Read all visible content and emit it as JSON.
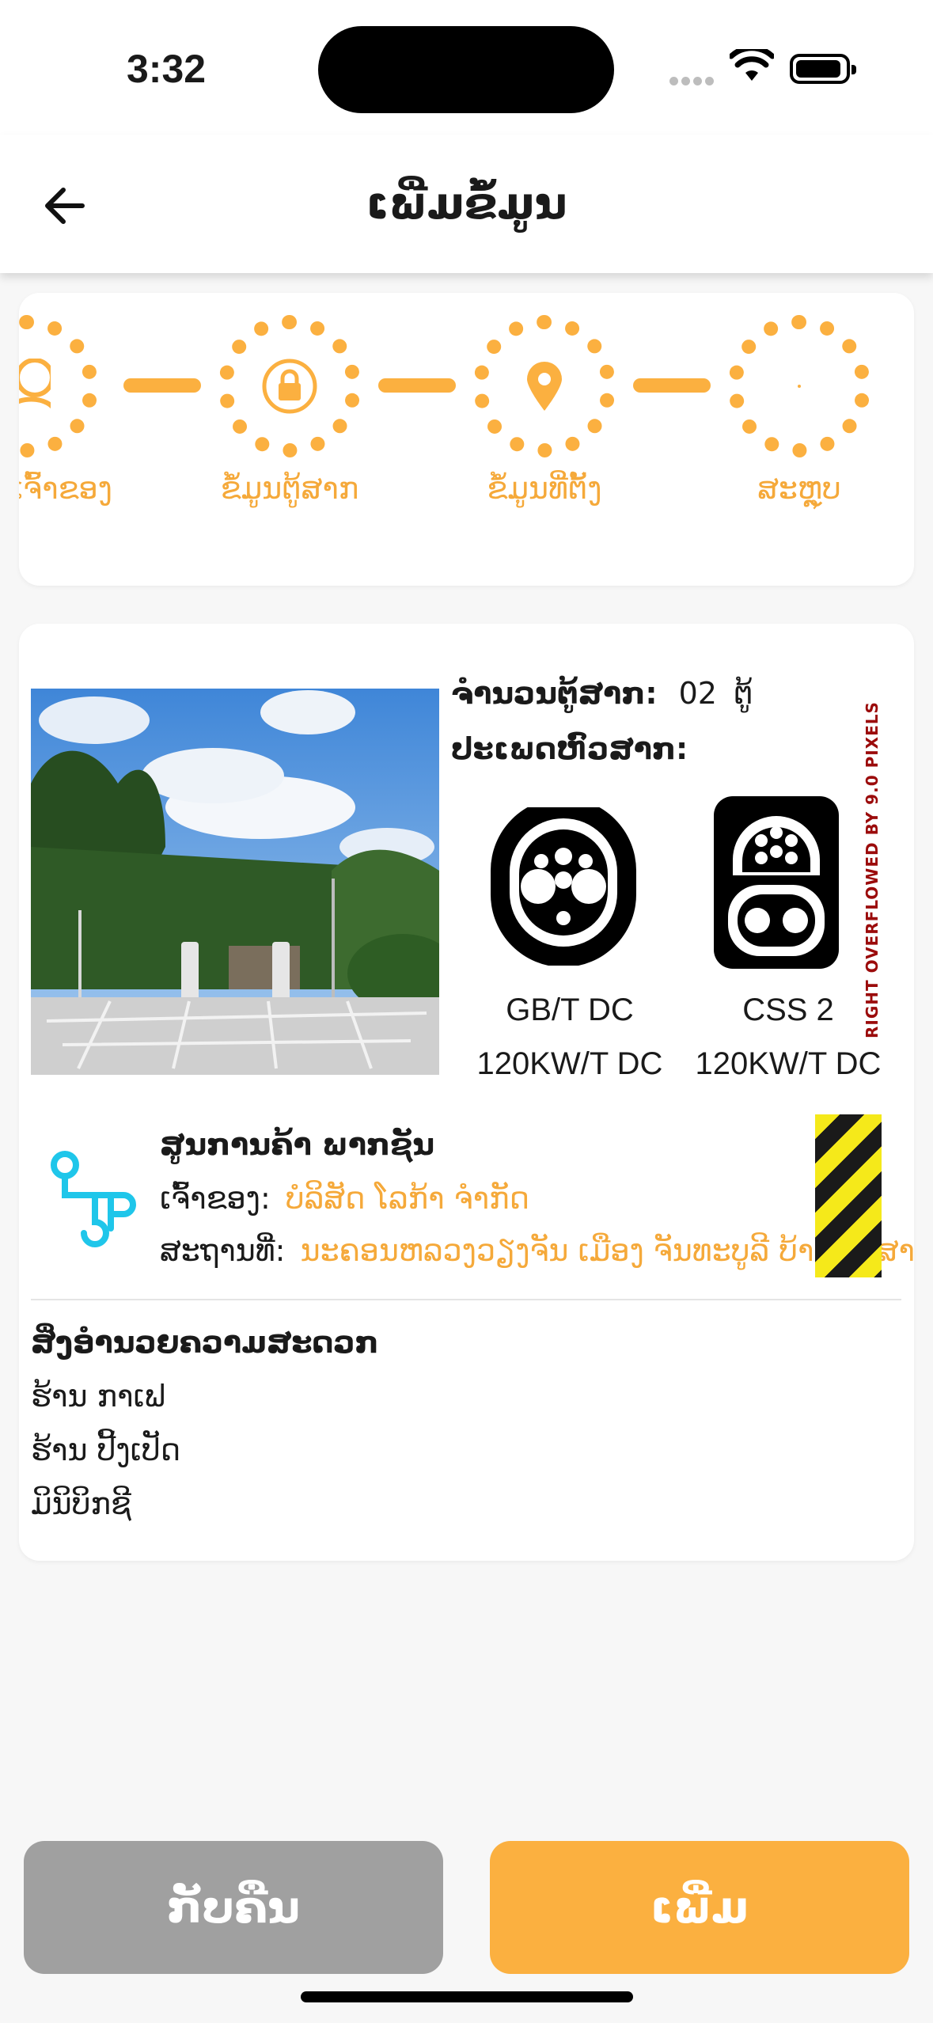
{
  "status_bar": {
    "time": "3:32"
  },
  "header": {
    "title": "ເພີ່ມຂໍ້ມູນ"
  },
  "stepper": {
    "steps": [
      {
        "label": "ເຈົ້າຂອງ"
      },
      {
        "label": "ຂໍ້ມູນຕູ້ສາກ"
      },
      {
        "label": "ຂໍ້ມູນທີ່ຕັ້ງ"
      },
      {
        "label": "ສະຫຼຸບ"
      }
    ]
  },
  "detail": {
    "count_label": "ຈຳນວນຕູ້ສາກ:",
    "count_value": "02",
    "count_unit": "ຕູ້",
    "plug_type_label": "ປະເພດຫົວສາກ:",
    "plugs": [
      {
        "name": "GB/T DC",
        "power": "120KW/T DC"
      },
      {
        "name": "CSS 2",
        "power": "120KW/T DC"
      }
    ],
    "station_name": "ສູນການຄ້າ ພາກຊັນ",
    "owner_label": "ເຈົ້າຂອງ:",
    "owner_value": "ບໍລິສັດ ໂລກ້າ ຈຳກັດ",
    "location_label": "ສະຖານທີ່:",
    "location_value": "ນະຄອນຫລວງວຽງຈັນ ເມືອງ ຈັນທະບູລີ ບ້ານ ທົ່ງສາງນາງ",
    "overflow_text": "RIGHT OVERFLOWED BY 9.0 PIXELS",
    "amenities_title": "ສິ່ງອຳນວຍຄວາມສະດວກ",
    "amenities": [
      "ຮ້ານ ກາເຟ",
      "ຮ້ານ ປີ້ງເປັດ",
      "ມິນິບິກຊີ"
    ]
  },
  "buttons": {
    "back_label": "ກັບຄືນ",
    "add_label": "ເພີ່ມ"
  },
  "colors": {
    "accent": "#fbb040",
    "grey_button": "#a0a0a0",
    "route_icon": "#1fc6ea"
  }
}
